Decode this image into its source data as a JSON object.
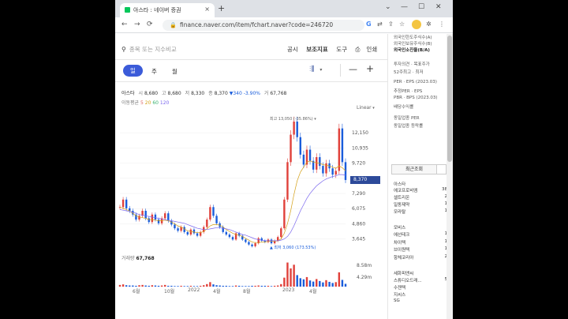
{
  "browser": {
    "tab_title": "아스타 : 네이버 증권",
    "tab_close": "×",
    "new_tab": "+",
    "url": "finance.naver.com/item/fchart.naver?code=246720",
    "nav_back": "←",
    "nav_forward": "→",
    "nav_reload": "⟳",
    "win_min": "⌄",
    "win_restore": "—",
    "win_max": "☐",
    "win_close": "✕"
  },
  "toolbar": {
    "search_placeholder": "종목 또는 지수비교",
    "menu": [
      "공시",
      "보조지표",
      "도구",
      "인쇄"
    ],
    "periods": [
      "일",
      "주",
      "월"
    ],
    "active_period": "일"
  },
  "quote": {
    "name": "아스타",
    "open_label": "시",
    "open": "8,680",
    "high_label": "고",
    "high": "8,680",
    "low_label": "저",
    "low": "8,330",
    "close_label": "종",
    "close": "8,370",
    "change": "▼340",
    "change_pct": "-3.90%",
    "volume_label": "거",
    "volume": "67,768"
  },
  "moving_avg": {
    "label": "이동평균",
    "periods": [
      "5",
      "20",
      "60",
      "120"
    ]
  },
  "scale_mode": "Linear",
  "high_label": "최고 13,050 (-35.86%) ▾",
  "low_label": "▲ 최저 3,060 (173.53%)",
  "last_price_tag": "8,370",
  "volume_panel": {
    "label": "거래량",
    "value": "67,768",
    "ticks": [
      "8.58m",
      "4.29m"
    ]
  },
  "chart_data": {
    "type": "line",
    "x_ticks": [
      "6월",
      "10월",
      "2022",
      "4월",
      "8월",
      "2023",
      "4월"
    ],
    "y_ticks": [
      12150,
      10935,
      9720,
      8505,
      7290,
      6075,
      4860,
      3645
    ],
    "y_tick_labels": [
      "12,150",
      "10,935",
      "9,720",
      "8,370",
      "7,290",
      "6,075",
      "4,860",
      "3,645"
    ],
    "ylim": [
      2800,
      13300
    ],
    "series": [
      {
        "values": [
          6200,
          6800,
          6100,
          5900,
          5600,
          5200,
          5500,
          5900,
          5300,
          5000,
          5600,
          5200,
          4900,
          5300,
          5700,
          5100,
          4800,
          4500,
          4300,
          4600,
          4200,
          4000,
          4400,
          4100,
          3900,
          4200,
          4600,
          5200,
          6200,
          5500,
          4900,
          4600,
          4200,
          4000,
          3800,
          3600,
          4100,
          3900,
          3600,
          3400,
          3200,
          3060,
          3300,
          3700,
          3500,
          3400,
          3600,
          3300,
          3500,
          3800,
          4500,
          6800,
          9800,
          12000,
          13050,
          11800,
          10400,
          9600,
          10800,
          9900,
          9200,
          10200,
          9500,
          8900,
          9700,
          9300,
          8800,
          9100,
          12500,
          9800,
          8370
        ]
      },
      {
        "values": [
          6200,
          6100,
          6000,
          5900,
          5700,
          5500,
          5400,
          5350,
          5300,
          5200,
          5200,
          5150,
          5100,
          5100,
          5150,
          5100,
          5000,
          4850,
          4700,
          4600,
          4450,
          4300,
          4250,
          4200,
          4150,
          4150,
          4250,
          4450,
          4700,
          4800,
          4800,
          4750,
          4600,
          4400,
          4250,
          4100,
          4000,
          3950,
          3850,
          3700,
          3550,
          3400,
          3350,
          3350,
          3400,
          3400,
          3450,
          3450,
          3450,
          3500,
          3650,
          4100,
          4900,
          5900,
          7200,
          8300,
          9000,
          9400,
          9800,
          9900,
          9800,
          9750,
          9700,
          9600,
          9550,
          9500,
          9400,
          9300,
          9500,
          9350,
          9100
        ]
      },
      {
        "values": [
          6000,
          5950,
          5900,
          5850,
          5800,
          5700,
          5600,
          5550,
          5500,
          5450,
          5400,
          5350,
          5300,
          5250,
          5200,
          5150,
          5100,
          5050,
          5000,
          4950,
          4900,
          4800,
          4700,
          4600,
          4500,
          4450,
          4400,
          4400,
          4450,
          4500,
          4550,
          4550,
          4500,
          4450,
          4400,
          4300,
          4200,
          4100,
          4000,
          3950,
          3850,
          3750,
          3650,
          3600,
          3550,
          3500,
          3500,
          3500,
          3500,
          3500,
          3550,
          3650,
          3850,
          4200,
          4700,
          5300,
          5900,
          6400,
          6900,
          7300,
          7600,
          7900,
          8100,
          8300,
          8450,
          8550,
          8650,
          8700,
          8800,
          8800,
          8750
        ]
      }
    ],
    "volume": [
      0.6,
      0.8,
      0.5,
      0.4,
      0.4,
      0.3,
      0.5,
      0.6,
      0.4,
      0.3,
      0.5,
      0.4,
      0.3,
      0.4,
      0.6,
      0.3,
      0.3,
      0.2,
      0.2,
      0.3,
      0.2,
      0.2,
      0.3,
      0.2,
      0.2,
      0.3,
      0.5,
      0.9,
      1.6,
      0.8,
      0.5,
      0.4,
      0.3,
      0.3,
      0.2,
      0.2,
      0.4,
      0.3,
      0.2,
      0.2,
      0.2,
      0.3,
      0.3,
      0.4,
      0.3,
      0.3,
      0.3,
      0.2,
      0.3,
      0.4,
      0.9,
      3.2,
      8.58,
      6.5,
      7.8,
      4.1,
      3.0,
      2.6,
      3.4,
      2.2,
      1.8,
      2.7,
      2.0,
      1.5,
      2.3,
      1.7,
      1.3,
      1.6,
      5.1,
      2.4,
      1.0
    ],
    "volume_max": 9.0,
    "grid": true
  },
  "right_panel": {
    "top_lines": [
      {
        "text": "외국인한도주식수(A)",
        "bold": false
      },
      {
        "text": "외국인보유주식수(B)",
        "bold": false
      },
      {
        "text": "외국인소진율(B/A)",
        "bold": true
      },
      {
        "text": "투자의견 · 목표주가",
        "bold": false
      },
      {
        "text": "52주최고 · 최저",
        "bold": false
      },
      {
        "text": "PER · EPS (2023.03)",
        "bold": false
      },
      {
        "text": "추정PER · EPS",
        "bold": false
      },
      {
        "text": "PBR · BPS (2023.03)",
        "bold": false
      },
      {
        "text": "배당수익률",
        "bold": false
      },
      {
        "text": "동일업종 PER",
        "bold": false
      },
      {
        "text": "동일업종 등락률",
        "bold": false
      }
    ],
    "recent_tab": "최근조회",
    "recent_items": [
      {
        "name": "아스타",
        "count": ""
      },
      {
        "name": "에코프로비엠",
        "count": "38"
      },
      {
        "name": "셀트리온",
        "count": "2"
      },
      {
        "name": "일동제약",
        "count": "1"
      },
      {
        "name": "모라탈",
        "count": "1"
      },
      {
        "name": "모비스",
        "count": ""
      },
      {
        "name": "에선테크",
        "count": "1"
      },
      {
        "name": "차이텍",
        "count": "1"
      },
      {
        "name": "브이원텍",
        "count": "1"
      },
      {
        "name": "항체코리아",
        "count": "2"
      },
      {
        "name": "세화피앤씨",
        "count": ""
      },
      {
        "name": "스튜디오드래...",
        "count": "5"
      },
      {
        "name": "수젠텍",
        "count": ""
      },
      {
        "name": "지씨스",
        "count": ""
      },
      {
        "name": "SG",
        "count": ""
      }
    ]
  },
  "colors": {
    "accent": "#3b5bd9",
    "up": "#e0403a",
    "down": "#1a5ddb",
    "ma20": "#d4a017",
    "ma60": "#7b68ee"
  }
}
